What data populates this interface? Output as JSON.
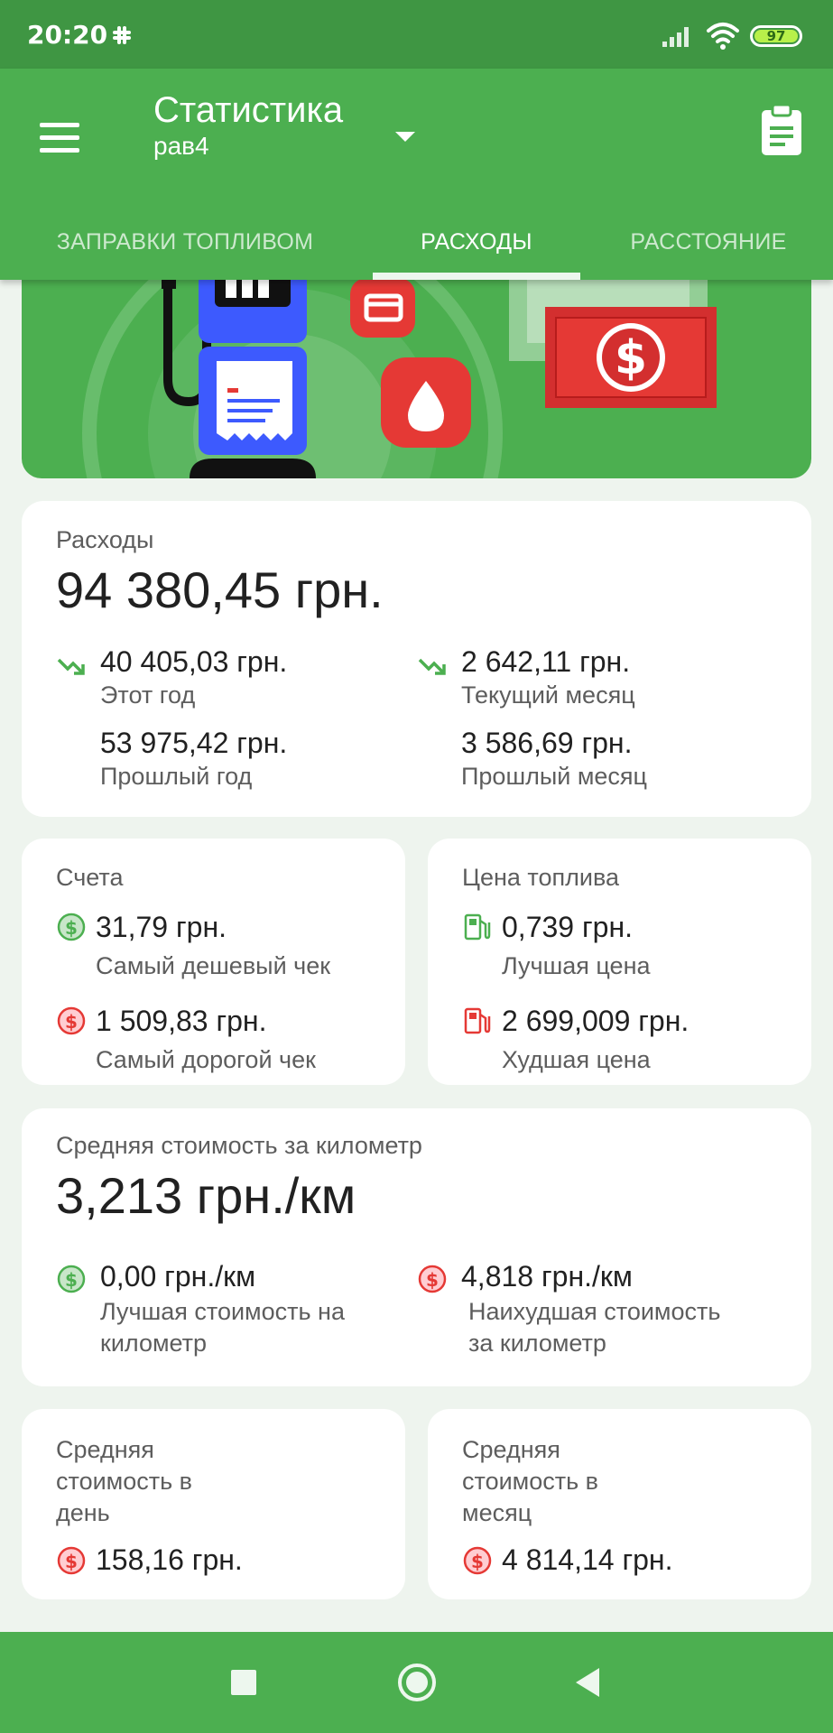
{
  "status_bar": {
    "time": "20:20",
    "battery": "97"
  },
  "app_bar": {
    "title": "Статистика",
    "subtitle": "рав4"
  },
  "tabs": [
    {
      "label": "ЗАПРАВКИ ТОПЛИВОМ",
      "active": false
    },
    {
      "label": "РАСХОДЫ",
      "active": true
    },
    {
      "label": "РАССТОЯНИЕ",
      "active": false
    }
  ],
  "expenses": {
    "label": "Расходы",
    "total": "94 380,45 грн.",
    "this_year": {
      "value": "40 405,03 грн.",
      "label": "Этот год"
    },
    "last_year": {
      "value": "53 975,42 грн.",
      "label": "Прошлый год"
    },
    "this_month": {
      "value": "2 642,11 грн.",
      "label": "Текущий месяц"
    },
    "last_month": {
      "value": "3 586,69 грн.",
      "label": "Прошлый месяц"
    }
  },
  "bills": {
    "label": "Счета",
    "cheapest": {
      "value": "31,79 грн.",
      "label": "Самый дешевый чек"
    },
    "priciest": {
      "value": "1 509,83 грн.",
      "label": "Самый дорогой чек"
    }
  },
  "fuel_price": {
    "label": "Цена топлива",
    "best": {
      "value": "0,739 грн.",
      "label": "Лучшая цена"
    },
    "worst": {
      "value": "2 699,009 грн.",
      "label": "Худшая цена"
    }
  },
  "per_km": {
    "label": "Средняя стоимость за километр",
    "total": "3,213 грн./км",
    "best": {
      "value": "0,00 грн./км",
      "label_line1": "Лучшая стоимость на",
      "label_line2": "километр"
    },
    "worst": {
      "value": "4,818 грн./км",
      "label_line1": "Наихудшая стоимость",
      "label_line2": "за километр"
    }
  },
  "per_day": {
    "line1": "Средняя",
    "line2": "стоимость в",
    "line3": "день",
    "value": "158,16 грн."
  },
  "per_month": {
    "line1": "Средняя",
    "line2": "стоимость в",
    "line3": "месяц",
    "value": "4 814,14 грн."
  },
  "colors": {
    "primary": "#4caf50",
    "status_bar": "#3f9643",
    "good": "#4caf50",
    "bad": "#e53935",
    "accent_red": "#d32f2f"
  }
}
